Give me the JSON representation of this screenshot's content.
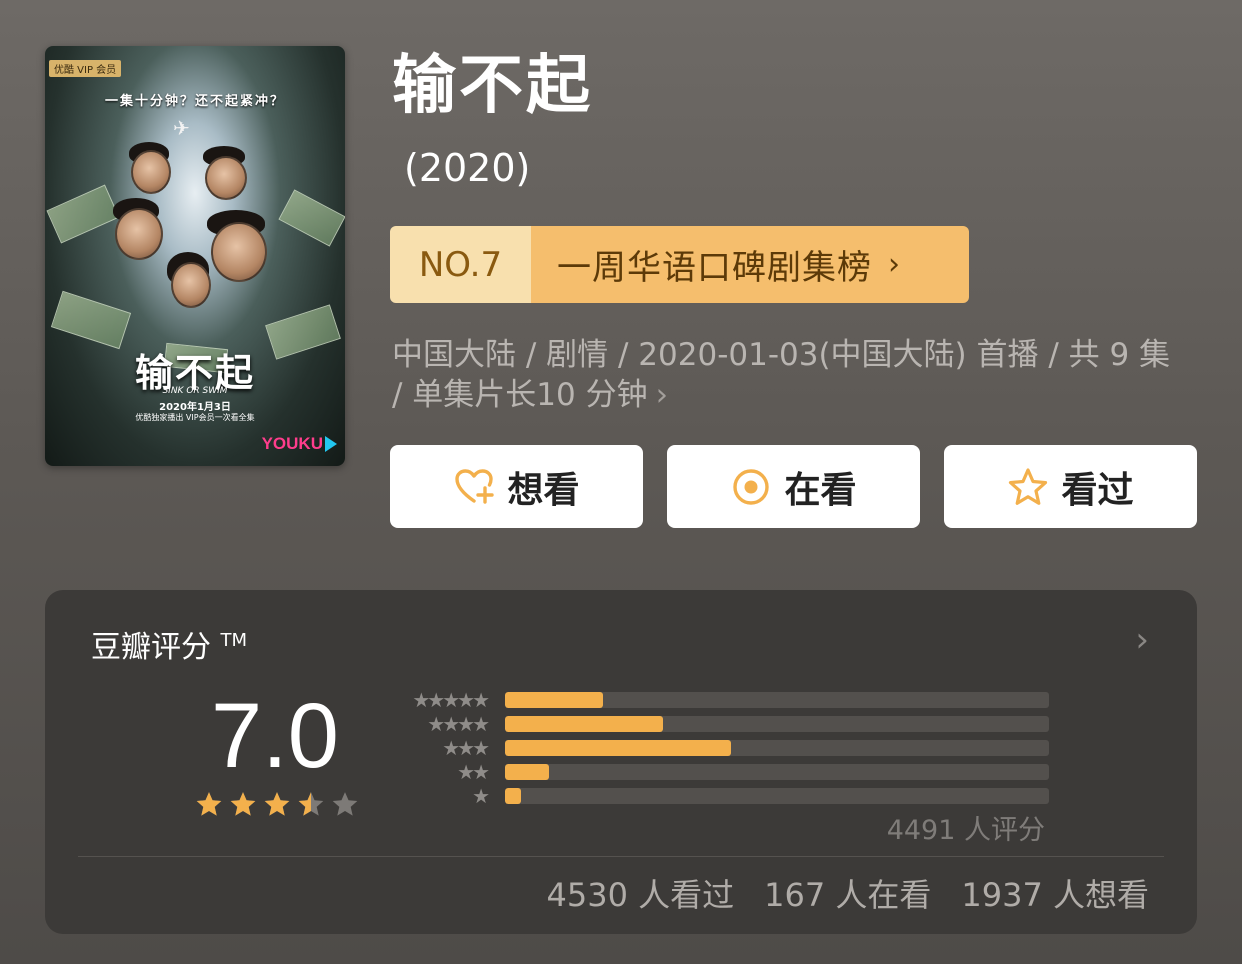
{
  "poster": {
    "vip_tag": "优酷 VIP 会员",
    "slogan": "一集十分钟？还不起紧冲？",
    "title_art": "输不起",
    "subtitle_art": "SINK OR SWIM",
    "date_line": "2020年1月3日",
    "exclusive_line": "优酷独家播出 VIP会员一次看全集",
    "logo": "YOUKU"
  },
  "title": "输不起",
  "year": "(2020)",
  "ranking": {
    "number": "NO.7",
    "label": "一周华语口碑剧集榜",
    "chevron": "›"
  },
  "meta": {
    "text": "中国大陆 / 剧情 / 2020-01-03(中国大陆) 首播 / 共 9 集 / 单集片长10 分钟",
    "chevron": "›"
  },
  "actions": [
    {
      "label": "想看",
      "icon": "heart-plus-icon"
    },
    {
      "label": "在看",
      "icon": "target-circle-icon"
    },
    {
      "label": "看过",
      "icon": "star-outline-icon"
    }
  ],
  "rating": {
    "title": "豆瓣评分",
    "trademark": "TM",
    "chevron": "›",
    "score": "7.0",
    "stars_value": 3.5,
    "distribution": [
      {
        "stars": "★★★★★",
        "percent": 18
      },
      {
        "stars": "★★★★",
        "percent": 29
      },
      {
        "stars": "★★★",
        "percent": 41.5
      },
      {
        "stars": "★★",
        "percent": 8
      },
      {
        "stars": "★",
        "percent": 3
      }
    ],
    "count": "4491 人评分",
    "watched": "4530 人看过",
    "watching": "167 人在看",
    "wish": "1937 人想看"
  },
  "colors": {
    "accent": "#f3b04c",
    "rank_no_bg": "#f8e0ae",
    "rank_label_bg": "#f5be6d",
    "card_bg": "#3c3a38"
  }
}
